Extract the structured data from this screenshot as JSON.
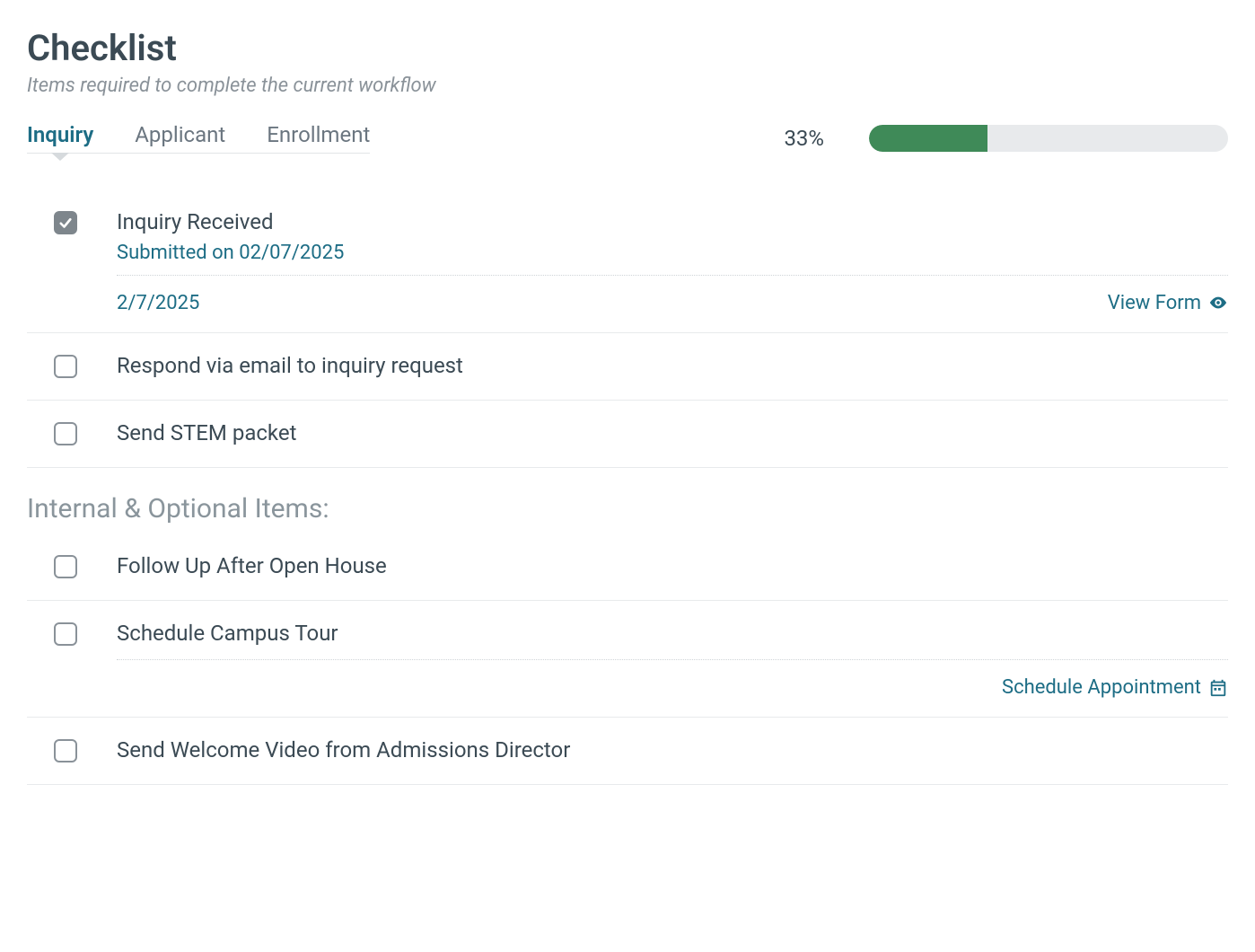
{
  "header": {
    "title": "Checklist",
    "subtitle": "Items required to complete the current workflow"
  },
  "tabs": [
    {
      "label": "Inquiry",
      "active": true
    },
    {
      "label": "Applicant",
      "active": false
    },
    {
      "label": "Enrollment",
      "active": false
    }
  ],
  "progress": {
    "percent_label": "33%",
    "percent_value": 33
  },
  "items": [
    {
      "title": "Inquiry Received",
      "checked": true,
      "subtitle": "Submitted on 02/07/2025",
      "detail_date": "2/7/2025",
      "view_form_label": "View Form"
    },
    {
      "title": "Respond via email to inquiry request",
      "checked": false
    },
    {
      "title": "Send STEM packet",
      "checked": false
    }
  ],
  "optional_heading": "Internal & Optional Items:",
  "optional_items": [
    {
      "title": "Follow Up After Open House",
      "checked": false
    },
    {
      "title": "Schedule Campus Tour",
      "checked": false,
      "schedule_label": "Schedule Appointment"
    },
    {
      "title": "Send Welcome Video from Admissions Director",
      "checked": false
    }
  ]
}
